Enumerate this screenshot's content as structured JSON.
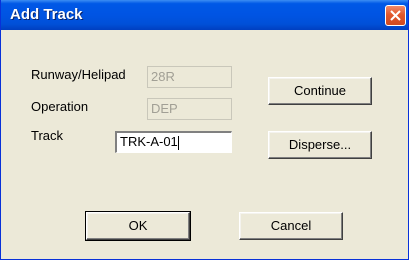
{
  "window": {
    "title": "Add Track",
    "close_icon": "close-x-icon"
  },
  "form": {
    "runway_label": "Runway/Helipad",
    "runway_value": "28R",
    "operation_label": "Operation",
    "operation_value": "DEP",
    "track_label": "Track",
    "track_value": "TRK-A-01"
  },
  "buttons": {
    "continue": "Continue",
    "disperse": "Disperse...",
    "ok": "OK",
    "cancel": "Cancel"
  }
}
